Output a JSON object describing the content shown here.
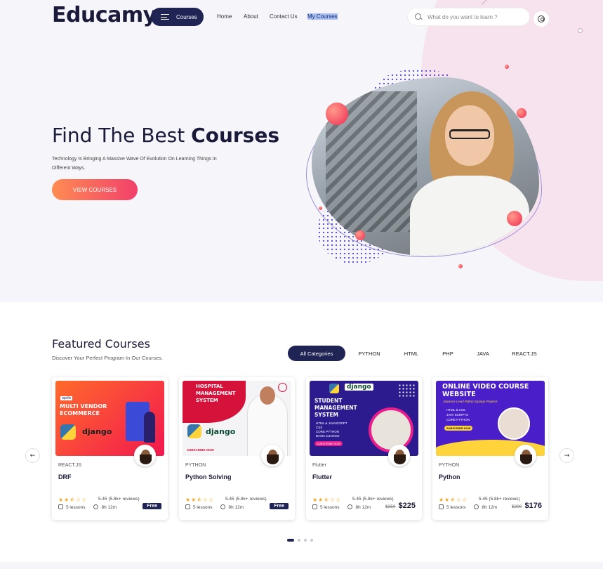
{
  "header": {
    "logo": "Educamy",
    "courses_button": "Courses",
    "nav": [
      {
        "label": "Home"
      },
      {
        "label": "About"
      },
      {
        "label": "Contact Us"
      },
      {
        "label": "My Courses"
      }
    ],
    "search_placeholder": "What do you want to learn ?"
  },
  "hero": {
    "title_light": "Find The Best",
    "title_bold": "Courses",
    "subtitle": "Technology Is Bringing A Massive Wave Of Evolution On Learning Things In Different Ways.",
    "cta": "VIEW COURSES"
  },
  "featured": {
    "title": "Featured Courses",
    "subtitle": "Discover Your Perfect Program In Our Courses.",
    "categories": [
      "All Categories",
      "PYTHON",
      "HTML",
      "PHP",
      "JAVA",
      "REACT.JS"
    ],
    "active_category": "All Categories",
    "prev_arrow": "←",
    "next_arrow": "→",
    "cards": [
      {
        "category": "REACT.JS",
        "title": "DRF",
        "thumb_title": "MULTI VENDOR ECOMMERCE",
        "thumb_kicker": "apollo",
        "thumb_sub": "django",
        "rating_text": "5.45 (5.8k+ reviews)",
        "stars": 2.5,
        "lessons": "5 lessons",
        "duration": "8h 12m",
        "price_label": "Free"
      },
      {
        "category": "PYTHON",
        "title": "Python Solving",
        "thumb_title": "HOSPITAL MANAGEMENT SYSTEM",
        "thumb_sub": "django",
        "thumb_cta": "SUBSCRIBE NOW",
        "rating_text": "5.45 (5.8k+ reviews)",
        "stars": 2.5,
        "lessons": "5 lessons",
        "duration": "8h 12m",
        "price_label": "Free"
      },
      {
        "category": "Flutter",
        "title": "Flutter",
        "thumb_title": "STUDENT MANAGEMENT SYSTEM",
        "thumb_sub": "django",
        "thumb_list": [
          "HTML & JAVASCRIPT",
          "CSS",
          "CORE PYTHON",
          "BASIC DJANGO"
        ],
        "thumb_cta": "SUBSCRIBE NOW",
        "rating_text": "5.45 (5.8k+ reviews)",
        "stars": 2.5,
        "lessons": "5 lessons",
        "duration": "8h 12m",
        "old_price": "$250",
        "new_price": "$225"
      },
      {
        "category": "PYTHON",
        "title": "Python",
        "thumb_title": "ONLINE VIDEO COURSE WEBSITE",
        "thumb_kicker": "Advance Level Python Django Projects",
        "thumb_list": [
          "HTML & CSS",
          "JAVA SCRIPTS",
          "CORE PYTHON"
        ],
        "thumb_cta": "SUBSCRIBE NOW",
        "rating_text": "5.45 (5.8k+ reviews)",
        "stars": 2.5,
        "lessons": "5 lessons",
        "duration": "8h 12m",
        "old_price": "$200",
        "new_price": "$176"
      }
    ],
    "pager": {
      "pages": 4,
      "current": 1
    }
  },
  "colors": {
    "navy": "#1f2454",
    "accent_gradient_start": "#ff8c52",
    "accent_gradient_end": "#f2406b",
    "hero_bg": "#f5f5fa",
    "hero_blob": "#f7e3ee",
    "star": "#f5a623"
  },
  "icons": [
    "menu-icon",
    "search-icon",
    "user-icon",
    "arrow-left-icon",
    "arrow-right-icon",
    "lessons-icon",
    "clock-icon",
    "star-icon"
  ]
}
